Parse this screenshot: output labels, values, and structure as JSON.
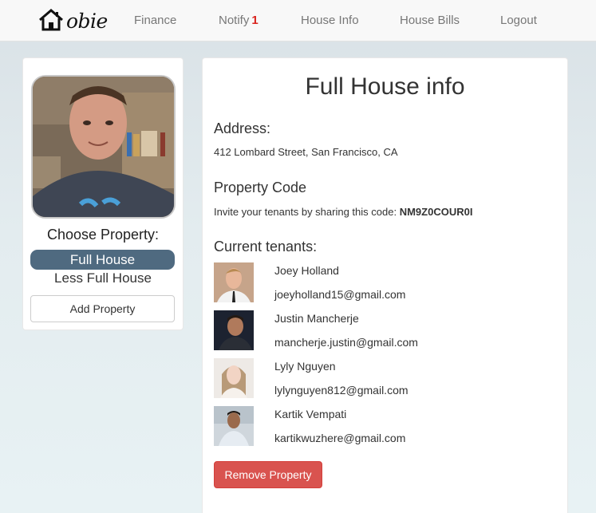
{
  "nav": {
    "brand": "obie",
    "items": [
      {
        "label": "Finance"
      },
      {
        "label": "Notify",
        "badge": "1"
      },
      {
        "label": "House Info"
      },
      {
        "label": "House Bills"
      },
      {
        "label": "Logout"
      }
    ]
  },
  "sidebar": {
    "choose_title": "Choose Property:",
    "properties": [
      "Full House",
      "Less Full House"
    ],
    "add_label": "Add Property"
  },
  "main": {
    "title": "Full House info",
    "address_heading": "Address:",
    "address": "412 Lombard Street, San Francisco, CA",
    "code_heading": "Property Code",
    "code_text": "Invite your tenants by sharing this code:",
    "code": "NM9Z0COUR0I",
    "tenants_heading": "Current tenants:",
    "tenants": [
      {
        "name": "Joey Holland",
        "email": "joeyholland15@gmail.com"
      },
      {
        "name": "Justin Mancherje",
        "email": "mancherje.justin@gmail.com"
      },
      {
        "name": "Lyly Nguyen",
        "email": "lylynguyen812@gmail.com"
      },
      {
        "name": "Kartik Vempati",
        "email": "kartikwuzhere@gmail.com"
      }
    ],
    "remove_label": "Remove Property"
  },
  "colors": {
    "selected_property": "#4f6a80",
    "danger": "#d9534f",
    "badge": "#d9231d"
  }
}
